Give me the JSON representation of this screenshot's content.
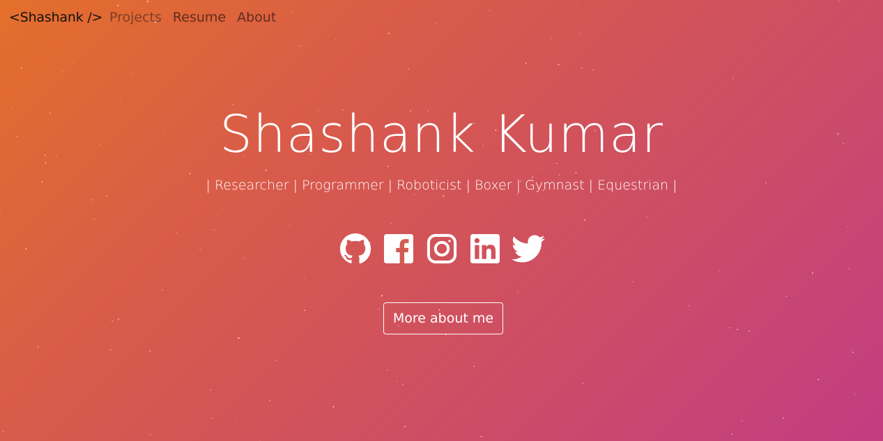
{
  "nav": {
    "brand": "<Shashank />",
    "links": [
      {
        "label": "Projects"
      },
      {
        "label": "Resume"
      },
      {
        "label": "About"
      }
    ]
  },
  "hero": {
    "name": "Shashank Kumar",
    "roles": "| Researcher | Programmer | Roboticist | Boxer | Gymnast | Equestrian |",
    "cta_label": "More about me"
  },
  "social_icons": [
    "github-icon",
    "facebook-icon",
    "instagram-icon",
    "linkedin-icon",
    "twitter-icon"
  ],
  "colors": {
    "gradient_start": "#e46f2b",
    "gradient_mid": "#cd4e64",
    "gradient_end": "#c23d82",
    "text": "#ffffff"
  }
}
